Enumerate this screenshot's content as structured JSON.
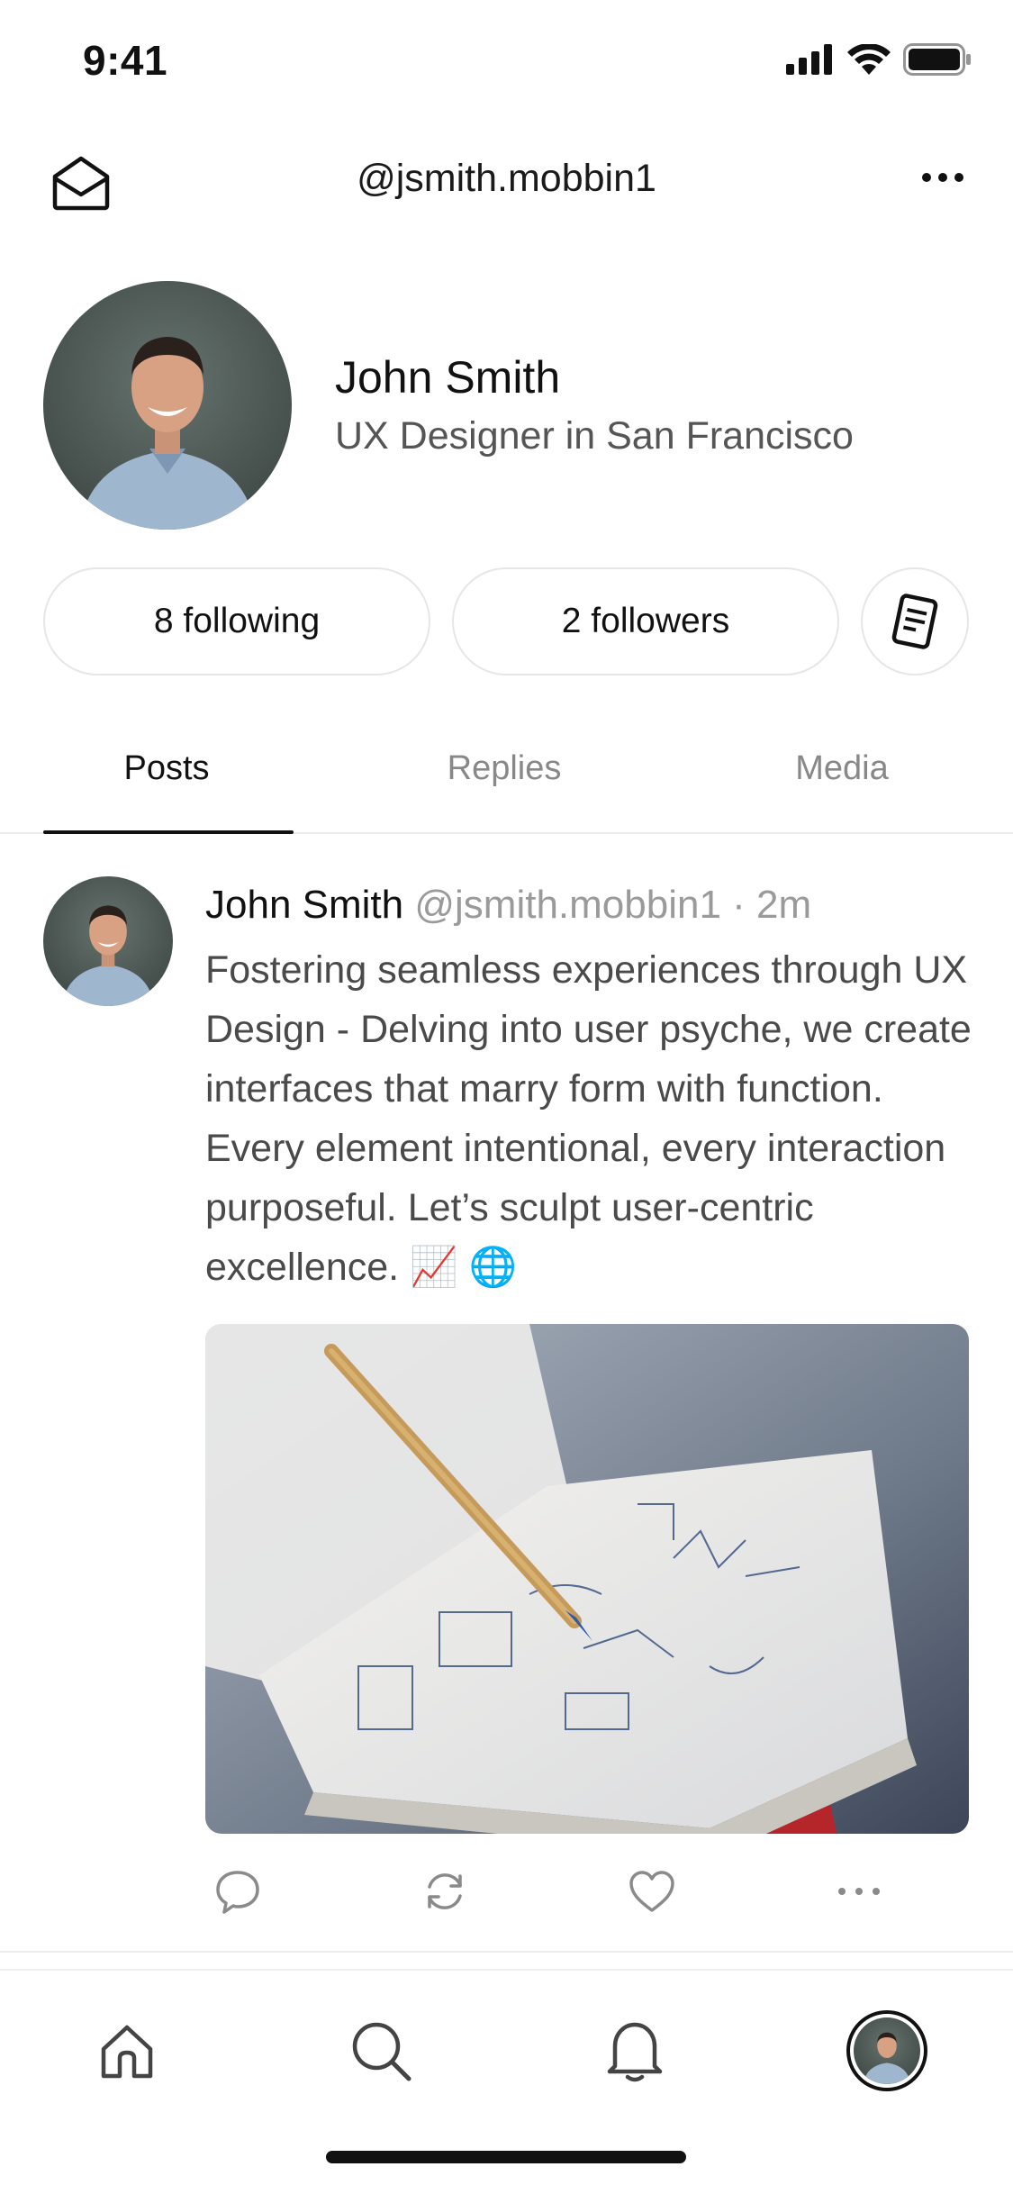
{
  "status_bar": {
    "time": "9:41"
  },
  "header": {
    "title": "@jsmith.mobbin1"
  },
  "profile": {
    "name": "John Smith",
    "bio": "UX Designer in San Francisco"
  },
  "stats": {
    "following": "8 following",
    "followers": "2 followers"
  },
  "tabs": [
    {
      "label": "Posts",
      "active": true
    },
    {
      "label": "Replies",
      "active": false
    },
    {
      "label": "Media",
      "active": false
    }
  ],
  "post": {
    "author_name": "John Smith",
    "author_handle_time": "@jsmith.mobbin1 · 2m",
    "text": "Fostering seamless experiences through UX Design - Delving into user psyche, we create interfaces that marry form with function. Every element intentional, every interaction purposeful. Let’s sculpt user-centric excellence. 📈 🌐"
  },
  "icons": {
    "header_left": "mail-open-icon",
    "header_right": "more-horizontal-icon",
    "notes": "note-icon",
    "post_actions": [
      "reply-icon",
      "repost-icon",
      "like-icon",
      "more-horizontal-icon"
    ],
    "tabbar": [
      "home-icon",
      "search-icon",
      "bell-icon",
      "profile-avatar"
    ]
  },
  "colors": {
    "text_primary": "#111111",
    "text_secondary": "#555555",
    "text_muted": "#9a9a9a",
    "divider": "#ececec"
  }
}
